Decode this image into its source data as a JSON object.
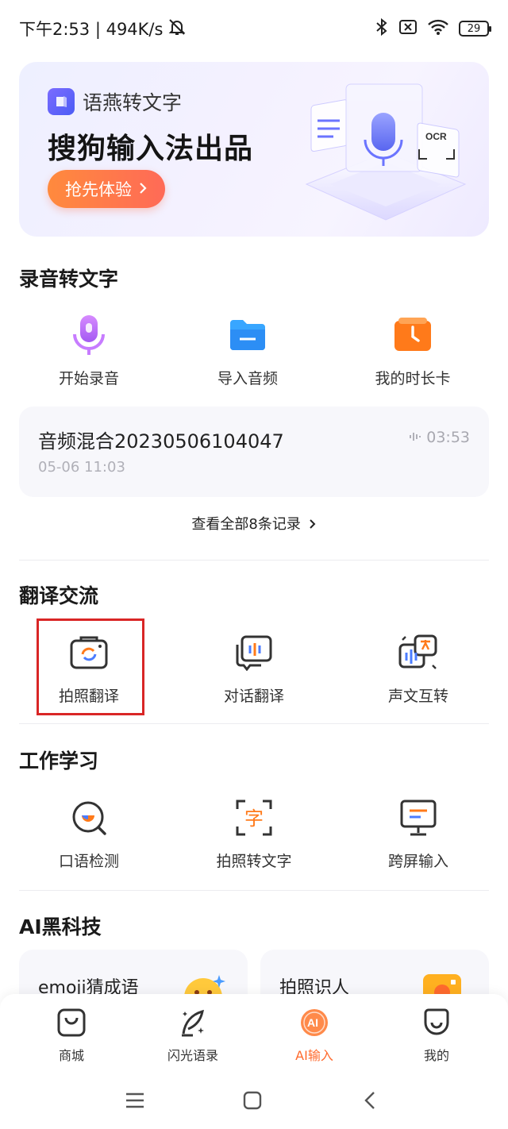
{
  "status_bar": {
    "time_speed": "下午2:53 | 494K/s",
    "battery": "29"
  },
  "banner": {
    "brand": "语燕转文字",
    "title": "搜狗输入法出品",
    "cta": "抢先体验",
    "art_ocr": "OCR"
  },
  "recording": {
    "section_title": "录音转文字",
    "tools": [
      {
        "label": "开始录音",
        "icon": "microphone-icon"
      },
      {
        "label": "导入音频",
        "icon": "folder-icon"
      },
      {
        "label": "我的时长卡",
        "icon": "clock-card-icon"
      }
    ],
    "record": {
      "name": "音频混合20230506104047",
      "time": "05-06 11:03",
      "duration": "03:53"
    },
    "view_all": "查看全部8条记录"
  },
  "translation": {
    "section_title": "翻译交流",
    "tools": [
      {
        "label": "拍照翻译",
        "icon": "camera-translate-icon"
      },
      {
        "label": "对话翻译",
        "icon": "dialog-translate-icon"
      },
      {
        "label": "声文互转",
        "icon": "voice-text-icon"
      }
    ]
  },
  "work": {
    "section_title": "工作学习",
    "tools": [
      {
        "label": "口语检测",
        "icon": "speech-check-icon"
      },
      {
        "label": "拍照转文字",
        "icon": "photo-to-text-icon"
      },
      {
        "label": "跨屏输入",
        "icon": "cross-screen-icon"
      }
    ],
    "ocr_glyph": "字"
  },
  "ai": {
    "section_title": "AI黑科技",
    "cards": [
      {
        "label": "emoji猜成语"
      },
      {
        "label": "拍照识人"
      }
    ]
  },
  "tabbar": {
    "items": [
      {
        "label": "商城",
        "icon": "shop-bag-icon"
      },
      {
        "label": "闪光语录",
        "icon": "quill-icon"
      },
      {
        "label": "AI输入",
        "icon": "ai-input-icon"
      },
      {
        "label": "我的",
        "icon": "profile-icon"
      }
    ],
    "active": "AI输入",
    "active_color": "#ff6a2d"
  },
  "colors": {
    "accent": "#ff6a2d",
    "highlight": "#d92626"
  }
}
